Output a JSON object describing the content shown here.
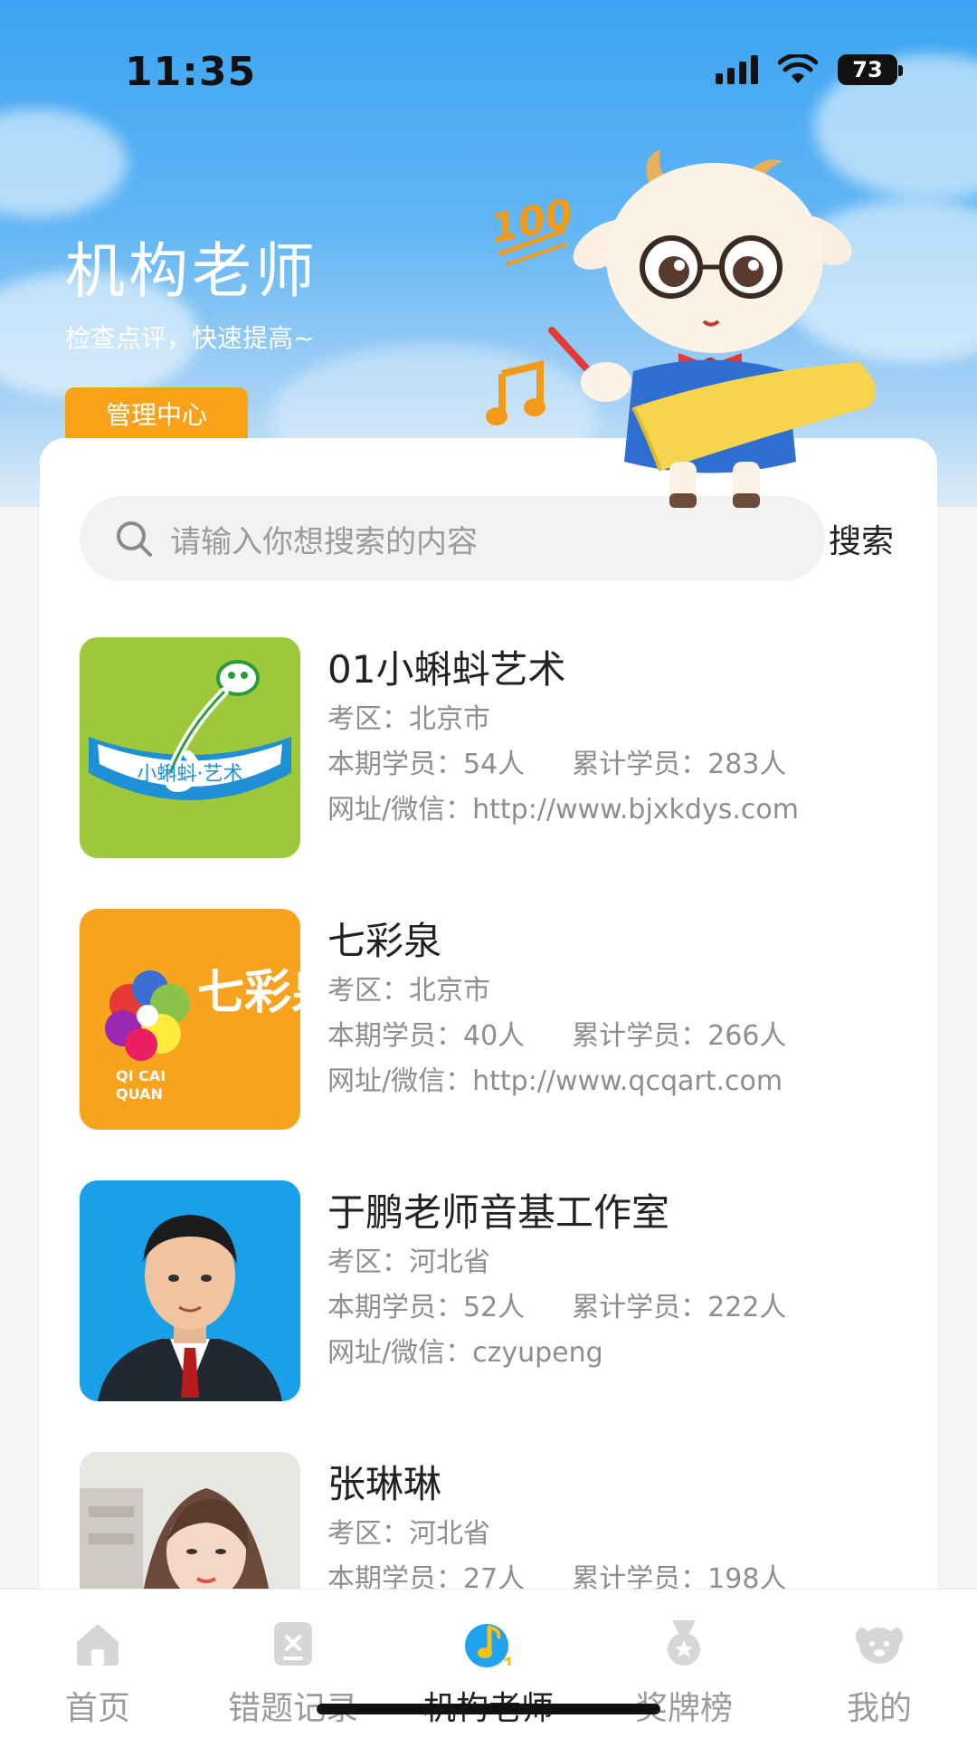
{
  "status_bar": {
    "time": "11:35",
    "battery": "73"
  },
  "header": {
    "title": "机构老师",
    "subtitle": "检查点评，快速提高~",
    "manage_button": "管理中心",
    "mascot_badge": "100"
  },
  "search": {
    "placeholder": "请输入你想搜索的内容",
    "button": "搜索"
  },
  "institutions": [
    {
      "name": "01小蝌蚪艺术",
      "region": "考区：北京市",
      "current_students": "本期学员：54人",
      "total_students": "累计学员：283人",
      "contact": "网址/微信：http://www.bjxkdys.com",
      "logo_text": "小蝌蚪·艺术"
    },
    {
      "name": "七彩泉",
      "region": "考区：北京市",
      "current_students": "本期学员：40人",
      "total_students": "累计学员：266人",
      "contact": "网址/微信：http://www.qcqart.com",
      "logo_text": "七彩泉",
      "logo_subtext_1": "QI CAI",
      "logo_subtext_2": "QUAN"
    },
    {
      "name": "于鹏老师音基工作室",
      "region": "考区：河北省",
      "current_students": "本期学员：52人",
      "total_students": "累计学员：222人",
      "contact": "网址/微信：czyupeng"
    },
    {
      "name": "张琳琳",
      "region": "考区：河北省",
      "current_students": "本期学员：27人",
      "total_students": "累计学员：198人",
      "contact": ""
    }
  ],
  "tabs": [
    {
      "label": "首页",
      "icon": "home-icon"
    },
    {
      "label": "错题记录",
      "icon": "mistake-record-icon"
    },
    {
      "label": "机构老师",
      "icon": "music-note-icon",
      "active": true
    },
    {
      "label": "奖牌榜",
      "icon": "medal-icon"
    },
    {
      "label": "我的",
      "icon": "profile-icon"
    }
  ],
  "colors": {
    "accent": "#f8a21a",
    "sky": "#3aa4f2",
    "active_tab": "#1fa3f0"
  }
}
